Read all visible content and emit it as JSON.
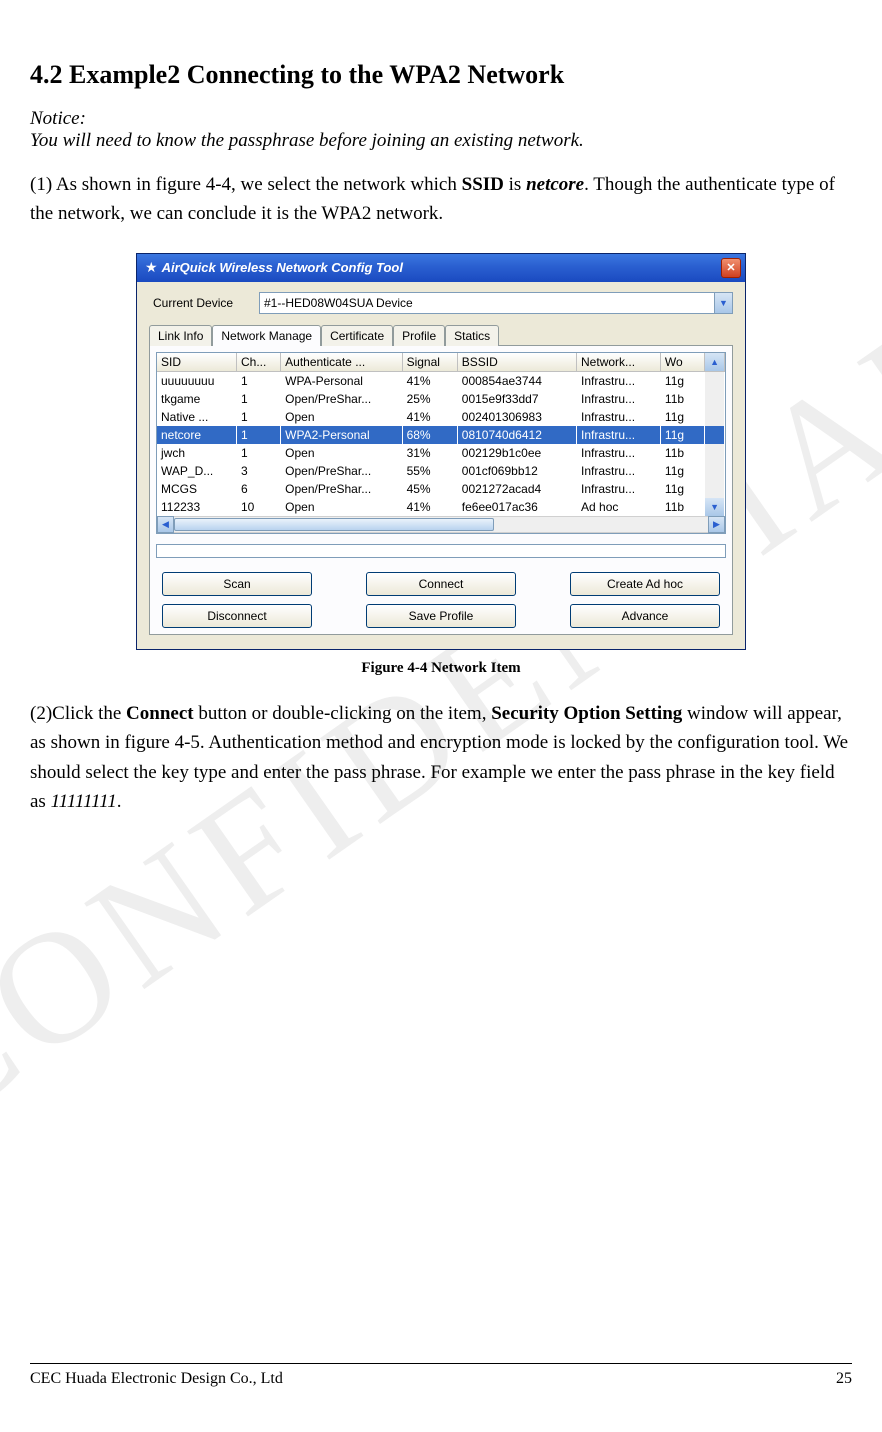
{
  "watermark": "CONFIDENTIAL",
  "heading": "4.2 Example2 Connecting to the WPA2 Network",
  "notice_label": "Notice:",
  "notice_text": "You will need to know the passphrase before joining an existing network.",
  "para1_prefix": "(1) As shown in figure 4-4, we select the network which ",
  "para1_ssid_label": "SSID",
  "para1_mid1": " is ",
  "para1_ssid_value": "netcore",
  "para1_suffix": ". Though the authenticate type of the network, we can conclude it is the WPA2 network.",
  "window": {
    "title": "AirQuick Wireless Network Config Tool",
    "device_label": "Current Device",
    "device_value": "#1--HED08W04SUA Device",
    "tabs": [
      "Link Info",
      "Network Manage",
      "Certificate",
      "Profile",
      "Statics"
    ],
    "active_tab_index": 1,
    "columns": [
      "SID",
      "Ch...",
      "Authenticate ...",
      "Signal",
      "BSSID",
      "Network...",
      "Wo"
    ],
    "rows": [
      {
        "sid": "uuuuuuuu",
        "ch": "1",
        "auth": "WPA-Personal",
        "signal": "41%",
        "bssid": "000854ae3744",
        "net": "Infrastru...",
        "wo": "11g",
        "selected": false
      },
      {
        "sid": "tkgame",
        "ch": "1",
        "auth": "Open/PreShar...",
        "signal": "25%",
        "bssid": "0015e9f33dd7",
        "net": "Infrastru...",
        "wo": "11b",
        "selected": false
      },
      {
        "sid": "Native ...",
        "ch": "1",
        "auth": "Open",
        "signal": "41%",
        "bssid": "002401306983",
        "net": "Infrastru...",
        "wo": "11g",
        "selected": false
      },
      {
        "sid": "netcore",
        "ch": "1",
        "auth": "WPA2-Personal",
        "signal": "68%",
        "bssid": "0810740d6412",
        "net": "Infrastru...",
        "wo": "11g",
        "selected": true
      },
      {
        "sid": "jwch",
        "ch": "1",
        "auth": "Open",
        "signal": "31%",
        "bssid": "002129b1c0ee",
        "net": "Infrastru...",
        "wo": "11b",
        "selected": false
      },
      {
        "sid": "WAP_D...",
        "ch": "3",
        "auth": "Open/PreShar...",
        "signal": "55%",
        "bssid": "001cf069bb12",
        "net": "Infrastru...",
        "wo": "11g",
        "selected": false
      },
      {
        "sid": "MCGS",
        "ch": "6",
        "auth": "Open/PreShar...",
        "signal": "45%",
        "bssid": "0021272acad4",
        "net": "Infrastru...",
        "wo": "11g",
        "selected": false
      },
      {
        "sid": "112233",
        "ch": "10",
        "auth": "Open",
        "signal": "41%",
        "bssid": "fe6ee017ac36",
        "net": "Ad hoc",
        "wo": "11b",
        "selected": false
      }
    ],
    "buttons_row1": [
      "Scan",
      "Connect",
      "Create Ad hoc"
    ],
    "buttons_row2": [
      "Disconnect",
      "Save Profile",
      "Advance"
    ]
  },
  "figure_caption": "Figure 4-4 Network Item",
  "para2_prefix": "(2)Click the ",
  "para2_connect": "Connect",
  "para2_mid1": " button or double-clicking on the item, ",
  "para2_secopt": "Security Option Setting",
  "para2_mid2": " window will appear, as shown in figure 4-5. Authentication method and encryption mode is locked by the configuration tool. We should select the key type and enter the pass phrase. For example we enter the pass phrase in the key field as ",
  "para2_passphrase": "11111111",
  "para2_end": ".",
  "footer_left": "CEC Huada Electronic Design Co., Ltd",
  "footer_right": "25"
}
